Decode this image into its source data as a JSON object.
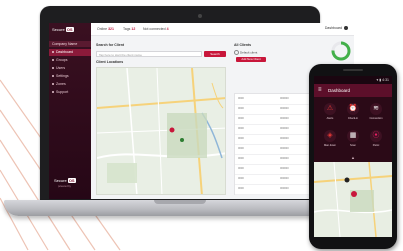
{
  "colors": {
    "brand": "#c8163a",
    "sidebar": "#2c0a19",
    "phone_appbar": "#5c0f2a",
    "alert": "#e53935",
    "wifi": "#ffffff",
    "panic": "#e91e63"
  },
  "laptop": {
    "logo_text": "Secure",
    "logo_mark": "OS",
    "sidebar": {
      "section_label": "Company Name",
      "items": [
        {
          "label": "Dashboard",
          "active": true
        },
        {
          "label": "Groups",
          "active": false
        },
        {
          "label": "Users",
          "active": false
        },
        {
          "label": "Settings",
          "active": false
        },
        {
          "label": "Zones",
          "active": false
        },
        {
          "label": "Support",
          "active": false
        }
      ],
      "footer_logo_text": "Secure",
      "footer_logo_mark": "OS",
      "footer_sub": "powered by"
    },
    "topbar": {
      "items": [
        {
          "label": "Online",
          "count": "321"
        },
        {
          "label": "Tags",
          "count": "12"
        },
        {
          "label": "Not connected",
          "count": "4"
        }
      ],
      "user": "Dashboard"
    },
    "search": {
      "label": "Search for Client",
      "placeholder": "Tap here to start the client name",
      "button": "Search"
    },
    "map_label": "Client Locations",
    "alerts": {
      "label": "All Clients",
      "radio_1": "Default client",
      "add_button": "Add New Client"
    },
    "table_rows": [
      [
        "0000",
        "000000",
        "000000"
      ],
      [
        "0000",
        "000000",
        "000000"
      ],
      [
        "0000",
        "000000",
        "000000"
      ],
      [
        "0000",
        "000000",
        "000000"
      ],
      [
        "0000",
        "000000",
        "000000"
      ],
      [
        "0000",
        "000000",
        "000000"
      ],
      [
        "0000",
        "000000",
        "000000"
      ],
      [
        "0000",
        "000000",
        "000000"
      ],
      [
        "0000",
        "000000",
        "000000"
      ],
      [
        "0000",
        "000000",
        "000000"
      ]
    ]
  },
  "phone": {
    "status": "▾ ▮ 4:31",
    "menu_icon": "≡",
    "title": "Dashboard",
    "tiles": [
      {
        "icon": "alert-triangle-icon",
        "glyph": "⚠",
        "label": "Alerts",
        "color": "#e53935"
      },
      {
        "icon": "alarm-clock-icon",
        "glyph": "⏰",
        "label": "Check-in",
        "color": "#ffffff"
      },
      {
        "icon": "wifi-icon",
        "glyph": "≋",
        "label": "Connection",
        "color": "#ffffff"
      },
      {
        "icon": "shield-icon",
        "glyph": "◈",
        "label": "Man down",
        "color": "#e53935"
      },
      {
        "icon": "qr-code-icon",
        "glyph": "▦",
        "label": "Scan",
        "color": "#ffffff"
      },
      {
        "icon": "panic-button-icon",
        "glyph": "⦿",
        "label": "Panic",
        "color": "#e91e63"
      }
    ],
    "handle": "▲"
  }
}
